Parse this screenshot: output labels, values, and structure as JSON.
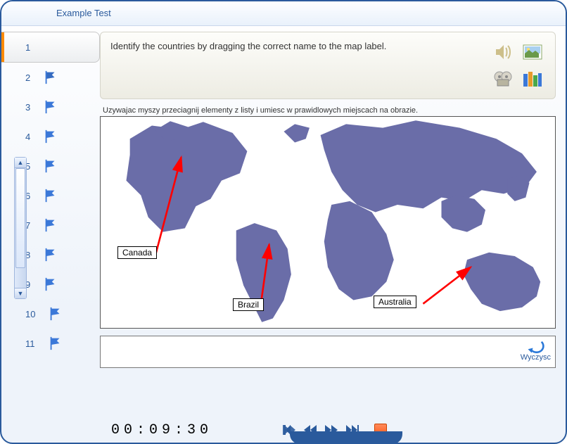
{
  "title": "Example Test",
  "question": {
    "number": 1,
    "text": "Identify the countries by dragging the correct name to the map label."
  },
  "nav": {
    "items": [
      {
        "n": "1"
      },
      {
        "n": "2"
      },
      {
        "n": "3"
      },
      {
        "n": "4"
      },
      {
        "n": "5"
      },
      {
        "n": "6"
      },
      {
        "n": "7"
      },
      {
        "n": "8"
      },
      {
        "n": "9"
      },
      {
        "n": "10"
      },
      {
        "n": "11"
      }
    ]
  },
  "instruction": "Uzywajac myszy przeciagnij elementy z listy i umiesc w prawidlowych miejscach na obrazie.",
  "labels": {
    "canada": "Canada",
    "brazil": "Brazil",
    "australia": "Australia"
  },
  "undo_label": "Wyczysc",
  "timer": "00:09:30",
  "icons": {
    "audio": "audio-icon",
    "image": "image-icon",
    "video": "video-icon",
    "library": "library-icon"
  }
}
